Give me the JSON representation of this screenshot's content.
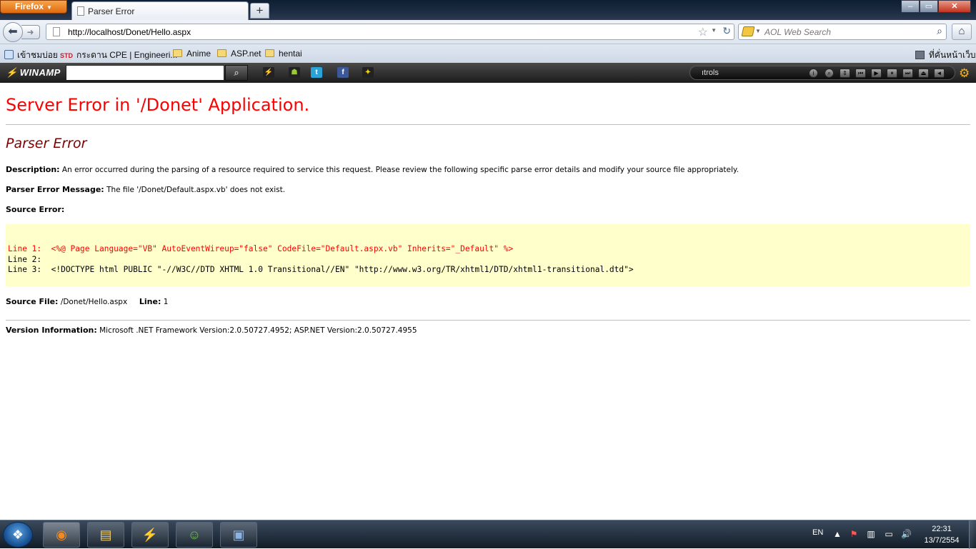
{
  "browser": {
    "app_button": "Firefox",
    "tab_title": "Parser Error",
    "new_tab_glyph": "+",
    "url": "http://localhost/Donet/Hello.aspx",
    "search_placeholder": "AOL Web Search"
  },
  "bookmarks": [
    {
      "label": "เข้าชมบ่อย",
      "icon": "recent-icon"
    },
    {
      "label": "กระดาน CPE | Engineeri...",
      "icon": "std-site-icon",
      "prefix": "STD"
    },
    {
      "label": "Anime",
      "icon": "folder-icon"
    },
    {
      "label": "ASP.net",
      "icon": "folder-icon"
    },
    {
      "label": "hentai",
      "icon": "folder-icon"
    }
  ],
  "bookmarks_right": "ที่คั่นหน้าเว็บ",
  "winamp": {
    "logo": "WINAMP",
    "controls_label": "ıtrols"
  },
  "page": {
    "title": "Server Error in '/Donet' Application.",
    "subtitle": "Parser Error",
    "description_label": "Description:",
    "description_text": "An error occurred during the parsing of a resource required to service this request. Please review the following specific parse error details and modify your source file appropriately.",
    "message_label": "Parser Error Message:",
    "message_text": "The file '/Donet/Default.aspx.vb' does not exist.",
    "source_error_label": "Source Error:",
    "source_lines": [
      "Line 1:  <%@ Page Language=\"VB\" AutoEventWireup=\"false\" CodeFile=\"Default.aspx.vb\" Inherits=\"_Default\" %>",
      "Line 2: ",
      "Line 3:  <!DOCTYPE html PUBLIC \"-//W3C//DTD XHTML 1.0 Transitional//EN\" \"http://www.w3.org/TR/xhtml1/DTD/xhtml1-transitional.dtd\">"
    ],
    "source_file_label": "Source File:",
    "source_file_value": "/Donet/Hello.aspx",
    "line_label": "Line:",
    "line_value": "1",
    "version_label": "Version Information:",
    "version_text": "Microsoft .NET Framework Version:2.0.50727.4952; ASP.NET Version:2.0.50727.4955"
  },
  "taskbar": {
    "language": "EN",
    "time": "22:31",
    "date": "13/7/2554"
  },
  "colors": {
    "error_title": "#ff0000",
    "subtitle": "#800000",
    "source_bg": "#ffffcc"
  }
}
